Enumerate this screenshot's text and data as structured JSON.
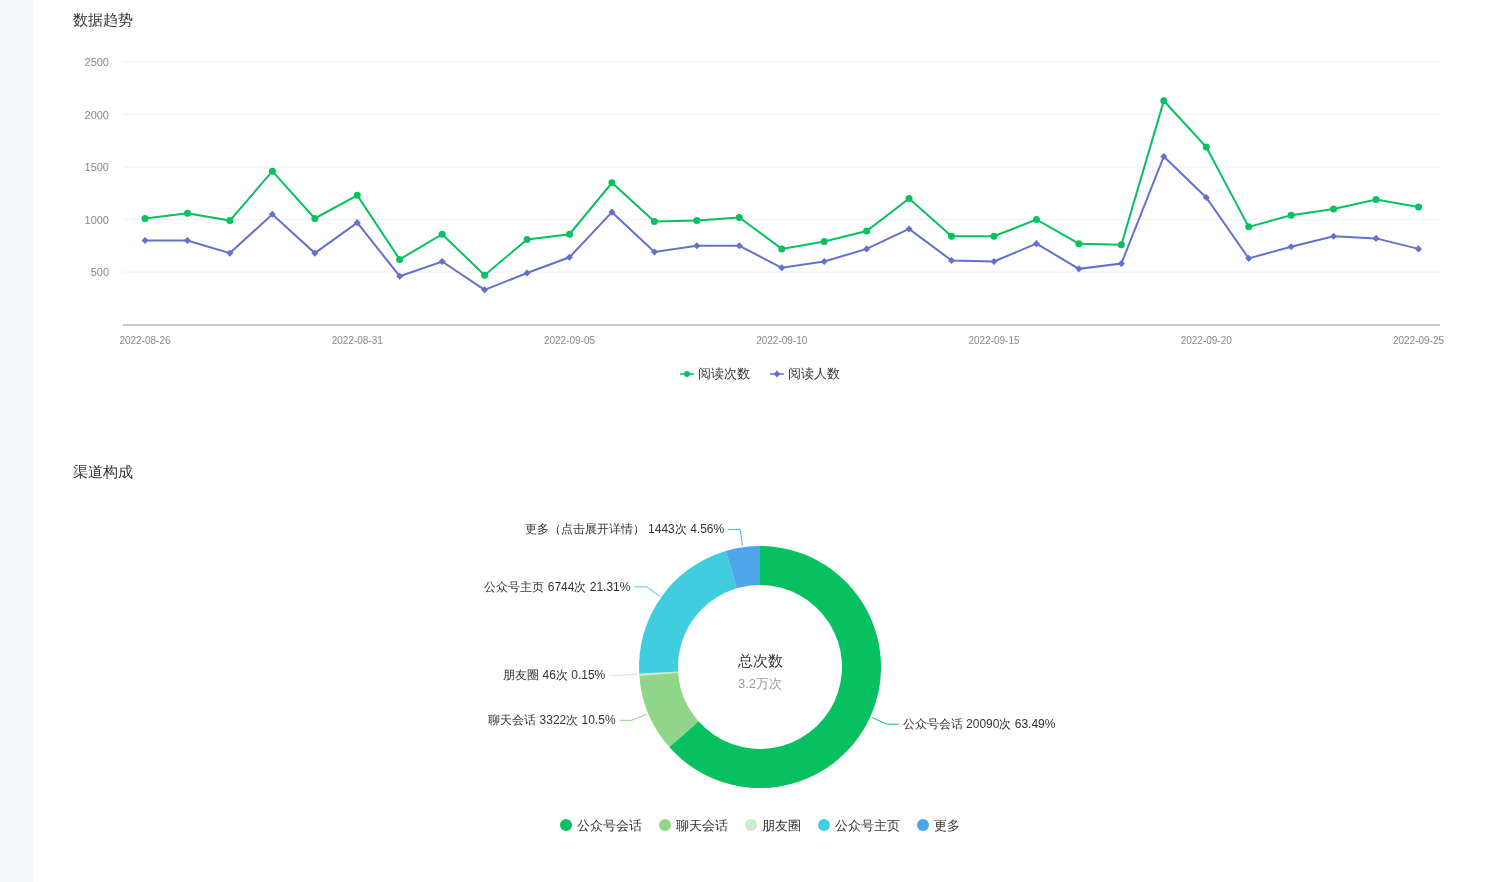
{
  "trend": {
    "title": "数据趋势",
    "chart_data": {
      "type": "line",
      "grid": true,
      "ylim": [
        0,
        2500
      ],
      "yticks": [
        500,
        1000,
        1500,
        2000,
        2500
      ],
      "categories": [
        "2022-08-26",
        null,
        null,
        null,
        null,
        "2022-08-31",
        null,
        null,
        null,
        null,
        "2022-09-05",
        null,
        null,
        null,
        null,
        "2022-09-10",
        null,
        null,
        null,
        null,
        "2022-09-15",
        null,
        null,
        null,
        null,
        "2022-09-20",
        null,
        null,
        null,
        null,
        "2022-09-25"
      ],
      "series": [
        {
          "name": "阅读次数",
          "color": "#07c160",
          "marker": "circle",
          "values": [
            1010,
            1060,
            990,
            1460,
            1010,
            1230,
            620,
            860,
            470,
            810,
            860,
            1350,
            980,
            990,
            1020,
            720,
            790,
            890,
            1200,
            840,
            840,
            1000,
            770,
            760,
            2130,
            1690,
            930,
            1040,
            1100,
            1190,
            1120
          ]
        },
        {
          "name": "阅读人数",
          "color": "#6470d0",
          "marker": "diamond",
          "values": [
            800,
            800,
            680,
            1050,
            680,
            970,
            460,
            600,
            330,
            490,
            640,
            1070,
            690,
            750,
            750,
            540,
            600,
            720,
            910,
            610,
            600,
            770,
            530,
            580,
            1600,
            1210,
            630,
            740,
            840,
            820,
            720
          ]
        }
      ]
    }
  },
  "channels": {
    "title": "渠道构成",
    "center_title": "总次数",
    "center_value": "3.2万次",
    "chart_data": {
      "type": "donut",
      "categories": [
        "公众号会话",
        "聊天会话",
        "朋友圈",
        "公众号主页",
        "更多"
      ],
      "series": [
        {
          "values": [
            63.49,
            10.5,
            0.15,
            21.31,
            4.56
          ]
        }
      ],
      "value_labels": [
        "公众号会话 20090次 63.49%",
        "聊天会话 3322次 10.5%",
        "朋友圈 46次 0.15%",
        "公众号主页 6744次 21.31%",
        "更多（点击展开详情） 1443次 4.56%"
      ]
    },
    "legend": [
      {
        "color": "#07c160"
      },
      {
        "color": "#8fd68a"
      },
      {
        "color": "#c9ecce"
      },
      {
        "color": "#40cde0"
      },
      {
        "color": "#4fa5ea"
      }
    ]
  }
}
